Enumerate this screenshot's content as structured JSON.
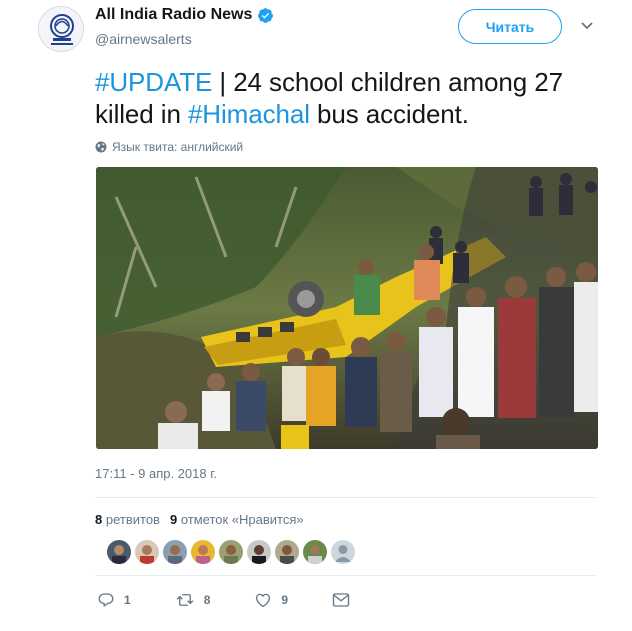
{
  "account": {
    "display_name": "All India Radio News",
    "handle": "@airnewsalerts",
    "verified": true,
    "follow_label": "Читать"
  },
  "tweet": {
    "hashtag1": "#UPDATE",
    "text1": " | 24 school children among 27 killed in ",
    "hashtag2": "#Himachal",
    "text2": " bus accident.",
    "language_note": "Язык твита: английский",
    "timestamp": "17:11 - 9 апр. 2018 г."
  },
  "stats": {
    "retweets_count": "8",
    "retweets_label": "ретвитов",
    "likes_count": "9",
    "likes_label": "отметок «Нравится»"
  },
  "actions": {
    "reply_count": "1",
    "retweet_count": "8",
    "like_count": "9"
  },
  "icons": {
    "verified": "verified-badge-icon",
    "caret": "chevron-down-icon",
    "globe": "globe-icon",
    "reply": "reply-icon",
    "retweet": "retweet-icon",
    "like": "heart-icon",
    "message": "envelope-icon"
  },
  "colors": {
    "accent": "#1da1f2",
    "link": "#1b95e0",
    "muted": "#657786",
    "text": "#14171a"
  }
}
